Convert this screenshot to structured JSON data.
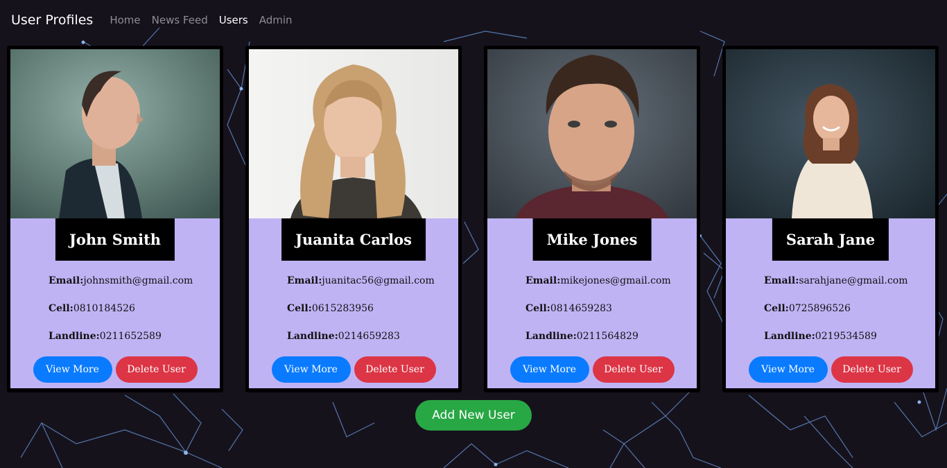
{
  "app": {
    "brand": "User Profiles",
    "nav": [
      {
        "label": "Home"
      },
      {
        "label": "News Feed"
      },
      {
        "label": "Users"
      },
      {
        "label": "Admin"
      }
    ]
  },
  "labels": {
    "email": "Email:",
    "cell": "Cell:",
    "landline": "Landline:",
    "view_more": "View More",
    "delete_user": "Delete User",
    "add_new_user": "Add New User"
  },
  "users": [
    {
      "name": "John Smith",
      "email": "johnsmith@gmail.com",
      "cell": "0810184526",
      "landline": "0211652589"
    },
    {
      "name": "Juanita Carlos",
      "email": "juanitac56@gmail.com",
      "cell": "0615283956",
      "landline": "0214659283"
    },
    {
      "name": "Mike Jones",
      "email": "mikejones@gmail.com",
      "cell": "0814659283",
      "landline": "0211564829"
    },
    {
      "name": "Sarah Jane",
      "email": "sarahjane@gmail.com",
      "cell": "0725896526",
      "landline": "0219534589"
    }
  ],
  "colors": {
    "background": "#16121c",
    "card_body": "#c0b3f4",
    "view_button": "#0a7bff",
    "delete_button": "#dc3545",
    "add_button": "#28a745",
    "network_lines": "#6c9ad6"
  }
}
